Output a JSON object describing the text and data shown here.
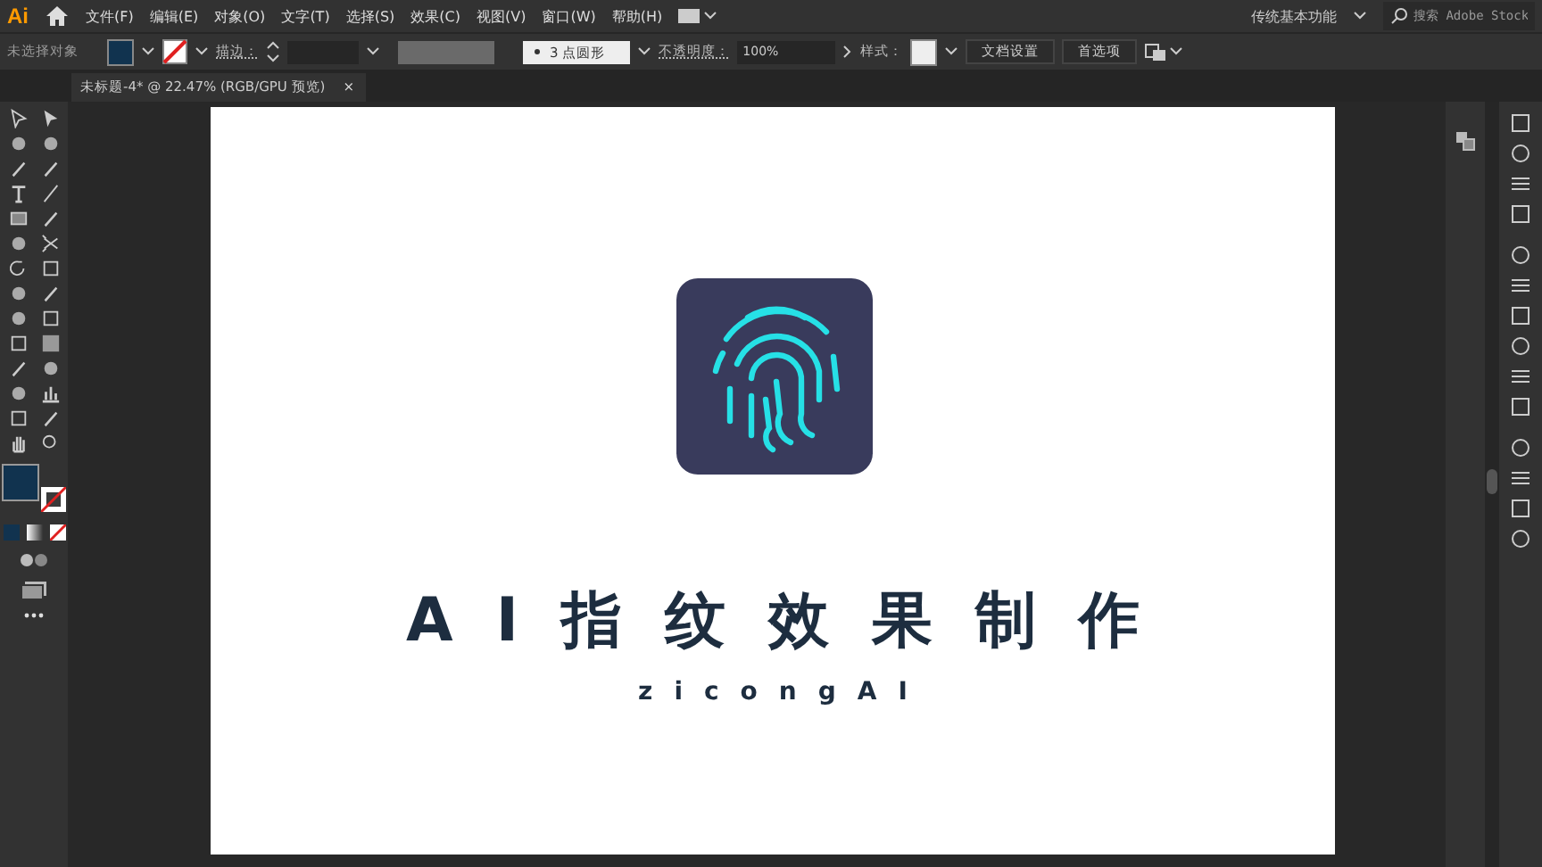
{
  "app": {
    "logo": "Ai"
  },
  "menu": [
    "文件(F)",
    "编辑(E)",
    "对象(O)",
    "文字(T)",
    "选择(S)",
    "效果(C)",
    "视图(V)",
    "窗口(W)",
    "帮助(H)"
  ],
  "workspace": "传统基本功能",
  "search": {
    "placeholder": "搜索 Adobe Stock"
  },
  "control_bar": {
    "selection": "未选择对象",
    "stroke_label": "描边：",
    "brush": "3 点圆形",
    "opacity_label": "不透明度：",
    "opacity": "100%",
    "style_label": "样式：",
    "buttons": [
      "文档设置",
      "首选项"
    ]
  },
  "document_tab": {
    "title": "未标题-4* @ 22.47% (RGB/GPU 预览)",
    "close": "×"
  },
  "artboard": {
    "title": "AI指纹效果制作",
    "subtitle": "zicongAI"
  }
}
